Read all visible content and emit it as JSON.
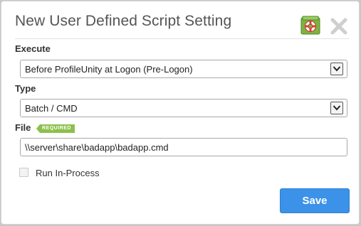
{
  "dialog": {
    "title": "New User Defined Script Setting",
    "help_icon": "lifebuoy-icon",
    "close_icon": "close-icon"
  },
  "execute": {
    "label": "Execute",
    "selected": "Before ProfileUnity at Logon (Pre-Logon)"
  },
  "type": {
    "label": "Type",
    "selected": "Batch / CMD"
  },
  "file": {
    "label": "File",
    "badge": "REQUIRED",
    "value": "\\\\server\\share\\badapp\\badapp.cmd"
  },
  "run_in_process": {
    "label": "Run In-Process",
    "checked": false
  },
  "actions": {
    "save_label": "Save"
  },
  "colors": {
    "accent": "#3c92e8",
    "required_badge": "#8cc04b",
    "help_icon_bg": "#7cb342"
  }
}
